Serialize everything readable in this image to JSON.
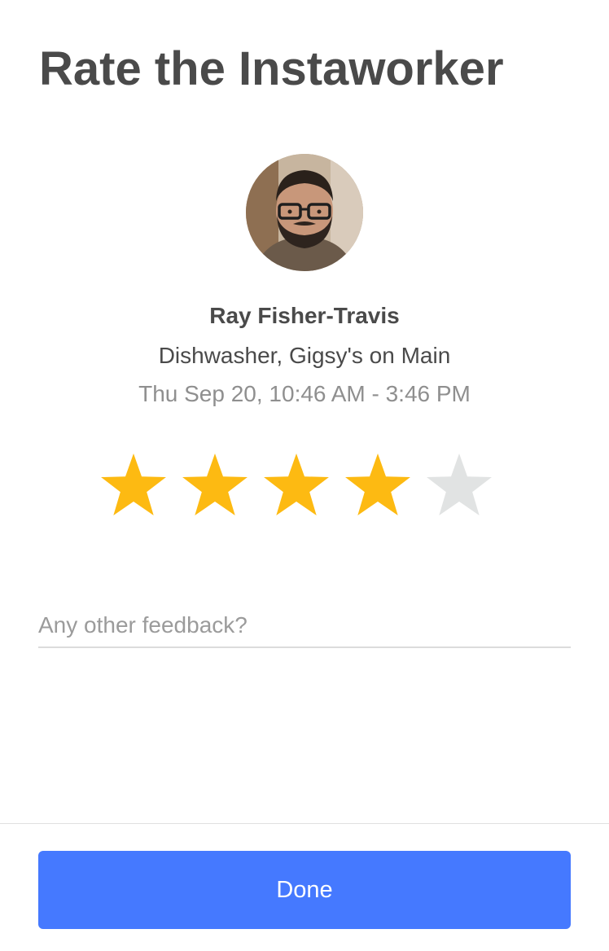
{
  "header": {
    "title": "Rate the Instaworker"
  },
  "worker": {
    "avatar": "worker-photo",
    "name": "Ray Fisher-Travis",
    "role": "Dishwasher, Gigsy's on Main",
    "shift": "Thu Sep 20, 10:46 AM - 3:46 PM"
  },
  "rating": {
    "value": 4,
    "max": 5,
    "icon": "star-icon",
    "filled_color": "#FDBA12",
    "empty_color": "#E1E3E3"
  },
  "feedback": {
    "value": "",
    "placeholder": "Any other feedback?"
  },
  "footer": {
    "done_label": "Done",
    "button_color": "#4579FF"
  }
}
